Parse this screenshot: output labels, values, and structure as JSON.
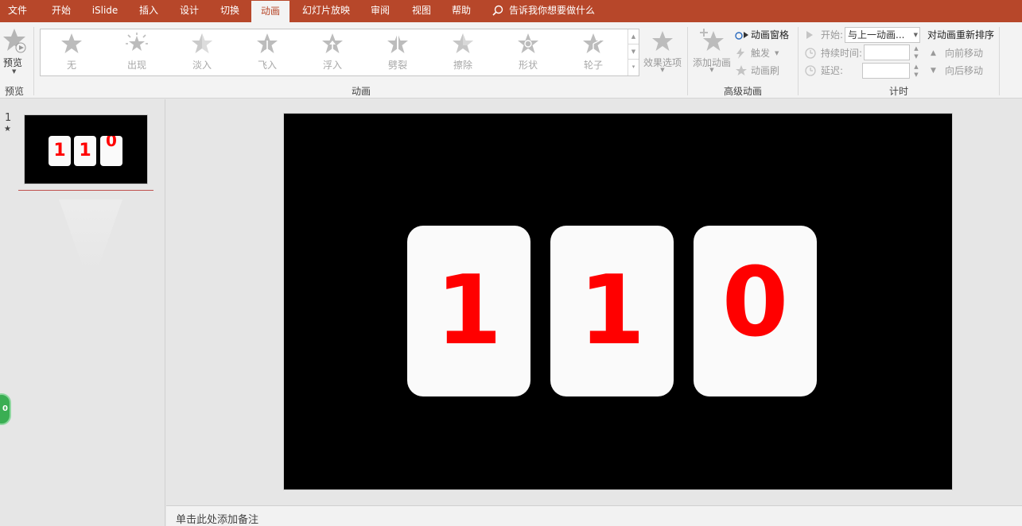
{
  "tabs": [
    {
      "label": "文件"
    },
    {
      "label": "开始"
    },
    {
      "label": "iSlide"
    },
    {
      "label": "插入"
    },
    {
      "label": "设计"
    },
    {
      "label": "切换"
    },
    {
      "label": "动画"
    },
    {
      "label": "幻灯片放映"
    },
    {
      "label": "审阅"
    },
    {
      "label": "视图"
    },
    {
      "label": "帮助"
    }
  ],
  "active_tab": "动画",
  "tell_me": "告诉我你想要做什么",
  "ribbon": {
    "preview": {
      "label": "预览",
      "group": "预览"
    },
    "animation_group": "动画",
    "gallery": [
      "无",
      "出现",
      "淡入",
      "飞入",
      "浮入",
      "劈裂",
      "擦除",
      "形状",
      "轮子"
    ],
    "effect_options": "效果选项",
    "advanced": {
      "group": "高级动画",
      "add_animation": "添加动画",
      "animation_pane": "动画窗格",
      "trigger": "触发",
      "painter": "动画刷"
    },
    "timing": {
      "group": "计时",
      "start_label": "开始:",
      "start_value": "与上一动画...",
      "duration_label": "持续时间:",
      "duration_value": "",
      "delay_label": "延迟:",
      "delay_value": "",
      "reorder": "对动画重新排序",
      "move_earlier": "向前移动",
      "move_later": "向后移动"
    }
  },
  "slides_panel": {
    "slide_number": "1",
    "star": "★",
    "thumb_digits": [
      "1",
      "1",
      "0"
    ],
    "badge": "0"
  },
  "slide": {
    "digits": [
      "1",
      "1",
      "0"
    ]
  },
  "notes_placeholder": "单击此处添加备注",
  "colors": {
    "tab_bar": "#b7472a",
    "digit": "#ff0000",
    "card": "#fafafa",
    "slide_bg": "#000000"
  }
}
